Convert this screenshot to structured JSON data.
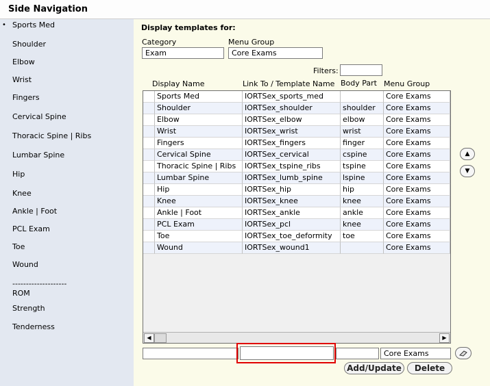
{
  "window": {
    "title": "Side Navigation"
  },
  "sidebar": {
    "items": [
      {
        "label": "Sports Med"
      },
      {
        "label": "Shoulder"
      },
      {
        "label": "Elbow"
      },
      {
        "label": "Wrist"
      },
      {
        "label": "Fingers"
      },
      {
        "label": "Cervical Spine"
      },
      {
        "label": "Thoracic Spine | Ribs"
      },
      {
        "label": "Lumbar Spine"
      },
      {
        "label": "Hip"
      },
      {
        "label": "Knee"
      },
      {
        "label": "Ankle | Foot"
      },
      {
        "label": "PCL Exam"
      },
      {
        "label": "Toe"
      },
      {
        "label": "Wound"
      },
      {
        "label": "--------------------"
      },
      {
        "label": "ROM"
      },
      {
        "label": "Strength"
      },
      {
        "label": "Tenderness"
      }
    ],
    "bullet": "•"
  },
  "form": {
    "heading": "Display templates for:",
    "category_label": "Category",
    "category_value": "Exam",
    "menu_group_label": "Menu Group",
    "menu_group_value": "Core Exams",
    "filters_label": "Filters:",
    "filters_value": ""
  },
  "table": {
    "columns": [
      "Display Name",
      "Link To / Template Name",
      "Body Part",
      "Menu Group"
    ],
    "rows": [
      [
        "Sports Med",
        "IORTSex_sports_med",
        "",
        "Core Exams"
      ],
      [
        "Shoulder",
        "IORTSex_shoulder",
        "shoulder",
        "Core Exams"
      ],
      [
        "Elbow",
        "IORTSex_elbow",
        "elbow",
        "Core Exams"
      ],
      [
        "Wrist",
        "IORTSex_wrist",
        "wrist",
        "Core Exams"
      ],
      [
        "Fingers",
        "IORTSex_fingers",
        "finger",
        "Core Exams"
      ],
      [
        "Cervical Spine",
        "IORTSex_cervical",
        "cspine",
        "Core Exams"
      ],
      [
        "Thoracic Spine | Ribs",
        "IORTSex_tspine_ribs",
        "tspine",
        "Core Exams"
      ],
      [
        "Lumbar Spine",
        "IORTSex_lumb_spine",
        "lspine",
        "Core Exams"
      ],
      [
        "Hip",
        "IORTSex_hip",
        "hip",
        "Core Exams"
      ],
      [
        "Knee",
        "IORTSex_knee",
        "knee",
        "Core Exams"
      ],
      [
        "Ankle | Foot",
        "IORTSex_ankle",
        "ankle",
        "Core Exams"
      ],
      [
        "PCL Exam",
        "IORTSex_pcl",
        "knee",
        "Core Exams"
      ],
      [
        "Toe",
        "IORTSex_toe_deformity",
        "toe",
        "Core Exams"
      ],
      [
        "Wound",
        "IORTSex_wound1",
        "",
        "Core Exams"
      ]
    ]
  },
  "edit": {
    "display_name": "",
    "template_name": "",
    "body_part": "",
    "menu_group": "Core Exams",
    "add_update_label": "Add/Update",
    "delete_label": "Delete"
  },
  "icons": {
    "move_up": "arrow-up-icon",
    "move_down": "arrow-down-icon",
    "eraser": "eraser-icon",
    "scroll_left": "scroll-left-icon",
    "scroll_right": "scroll-right-icon"
  },
  "colors": {
    "sidebar_bg": "#e3e8f1",
    "main_bg": "#fbfbe9",
    "row_even": "#ffffff",
    "row_odd": "#eef2fb",
    "highlight": "#e00000"
  }
}
